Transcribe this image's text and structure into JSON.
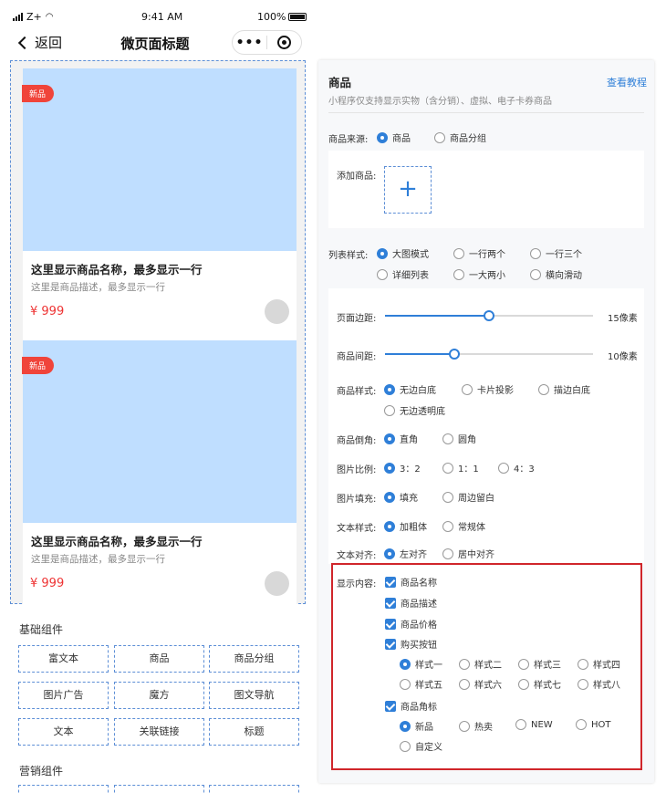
{
  "status_bar": {
    "carrier": "Z+",
    "time": "9:41 AM",
    "battery": "100%"
  },
  "navbar": {
    "back_label": "返回",
    "title": "微页面标题"
  },
  "cards": [
    {
      "badge": "新品",
      "title": "这里显示商品名称，最多显示一行",
      "desc": "这里是商品描述，最多显示一行",
      "price": "¥ 999"
    },
    {
      "badge": "新品",
      "title": "这里显示商品名称，最多显示一行",
      "desc": "这里是商品描述，最多显示一行",
      "price": "¥ 999"
    }
  ],
  "basic_components": {
    "title": "基础组件",
    "items": [
      "富文本",
      "商品",
      "商品分组",
      "图片广告",
      "魔方",
      "图文导航",
      "文本",
      "关联链接",
      "标题"
    ]
  },
  "marketing_components": {
    "title": "营销组件"
  },
  "panel": {
    "title": "商品",
    "tutorial_link": "查看教程",
    "subtitle": "小程序仅支持显示实物（含分销）、虚拟、电子卡券商品",
    "source": {
      "label": "商品来源:",
      "options": [
        "商品",
        "商品分组"
      ],
      "selected": 0
    },
    "add": {
      "label": "添加商品:",
      "plus": "+"
    },
    "list_style": {
      "label": "列表样式:",
      "options": [
        "大图模式",
        "一行两个",
        "一行三个",
        "详细列表",
        "一大两小",
        "横向滑动"
      ],
      "selected": 0
    },
    "page_margin": {
      "label": "页面边距:",
      "value": "15像素",
      "percent": 50
    },
    "item_spacing": {
      "label": "商品间距:",
      "value": "10像素",
      "percent": 33
    },
    "item_style": {
      "label": "商品样式:",
      "options": [
        "无边白底",
        "卡片投影",
        "描边白底",
        "无边透明底"
      ],
      "selected": 0
    },
    "corner": {
      "label": "商品倒角:",
      "options": [
        "直角",
        "圆角"
      ],
      "selected": 0
    },
    "ratio": {
      "label": "图片比例:",
      "options": [
        "3：2",
        "1：1",
        "4：3"
      ],
      "selected": 0
    },
    "fill": {
      "label": "图片填充:",
      "options": [
        "填充",
        "周边留白"
      ],
      "selected": 0
    },
    "text_style": {
      "label": "文本样式:",
      "options": [
        "加粗体",
        "常规体"
      ],
      "selected": 0
    },
    "text_align": {
      "label": "文本对齐:",
      "options": [
        "左对齐",
        "居中对齐"
      ],
      "selected": 0
    },
    "display": {
      "label": "显示内容:",
      "checks": [
        "商品名称",
        "商品描述",
        "商品价格",
        "购买按钮",
        "商品角标"
      ],
      "button_styles": [
        "样式一",
        "样式二",
        "样式三",
        "样式四",
        "样式五",
        "样式六",
        "样式七",
        "样式八"
      ],
      "button_selected": 0,
      "corner_marks": [
        "新品",
        "热卖",
        "NEW",
        "HOT",
        "自定义"
      ],
      "corner_selected": 0
    }
  },
  "colors": {
    "accent": "#2f7fd8",
    "badge": "#f0443a",
    "price": "#e33333",
    "highlight": "#d0262b",
    "image_placeholder": "#bfdeff"
  }
}
